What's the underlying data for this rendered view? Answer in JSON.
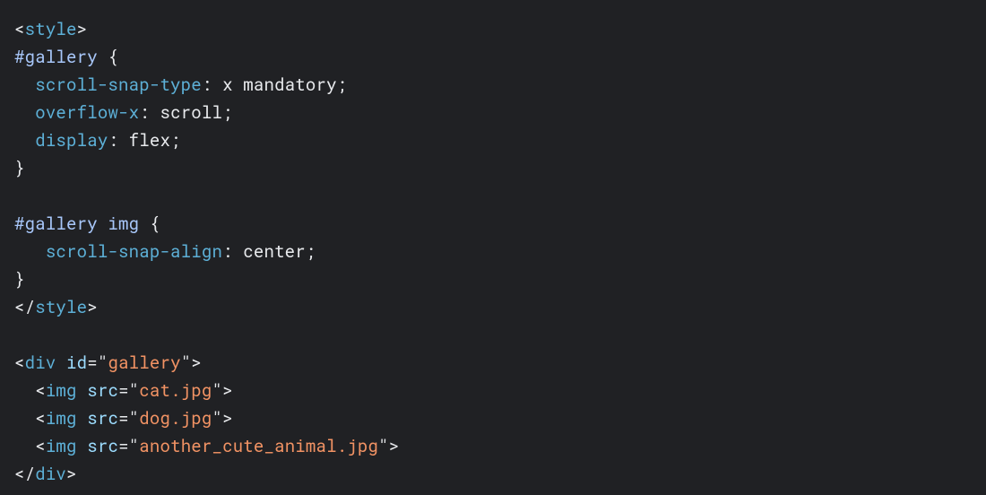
{
  "code": {
    "tags": {
      "style_open": "style",
      "style_close": "style",
      "div_open": "div",
      "div_close": "div",
      "img": "img"
    },
    "selectors": {
      "gallery": "#gallery",
      "gallery_img": "#gallery img"
    },
    "props": {
      "scroll_snap_type": "scroll-snap-type",
      "overflow_x": "overflow-x",
      "display": "display",
      "scroll_snap_align": "scroll-snap-align"
    },
    "vals": {
      "scroll_snap_type": "x mandatory",
      "overflow_x": "scroll",
      "display": "flex",
      "scroll_snap_align": "center"
    },
    "attrs": {
      "id": "id",
      "src": "src"
    },
    "strings": {
      "gallery": "gallery",
      "cat": "cat.jpg",
      "dog": "dog.jpg",
      "animal": "another_cute_animal.jpg"
    }
  }
}
